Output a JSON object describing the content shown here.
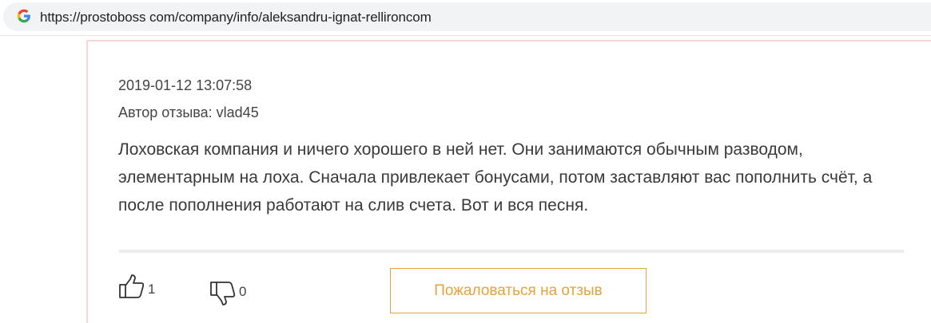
{
  "browser": {
    "url": "https://prostoboss com/company/info/aleksandru-ignat-rellironcom",
    "favicon": "google-g-icon"
  },
  "review": {
    "date": "2019-01-12 13:07:58",
    "author": "Автор отзыва: vlad45",
    "text": "Лоховская компания и ничего хорошего в ней нет. Они занимаются обычным разводом, элементарным на лоха. Сначала привлекает бонусами, потом заставляют вас пополнить счёт, а после пополнения работают на слив счета. Вот и вся песня."
  },
  "actions": {
    "likes": "1",
    "dislikes": "0",
    "like_icon": "thumbs-up-icon",
    "dislike_icon": "thumbs-down-icon",
    "complain_label": "Пожаловаться на отзыв",
    "accent_color": "#e8a23c"
  }
}
